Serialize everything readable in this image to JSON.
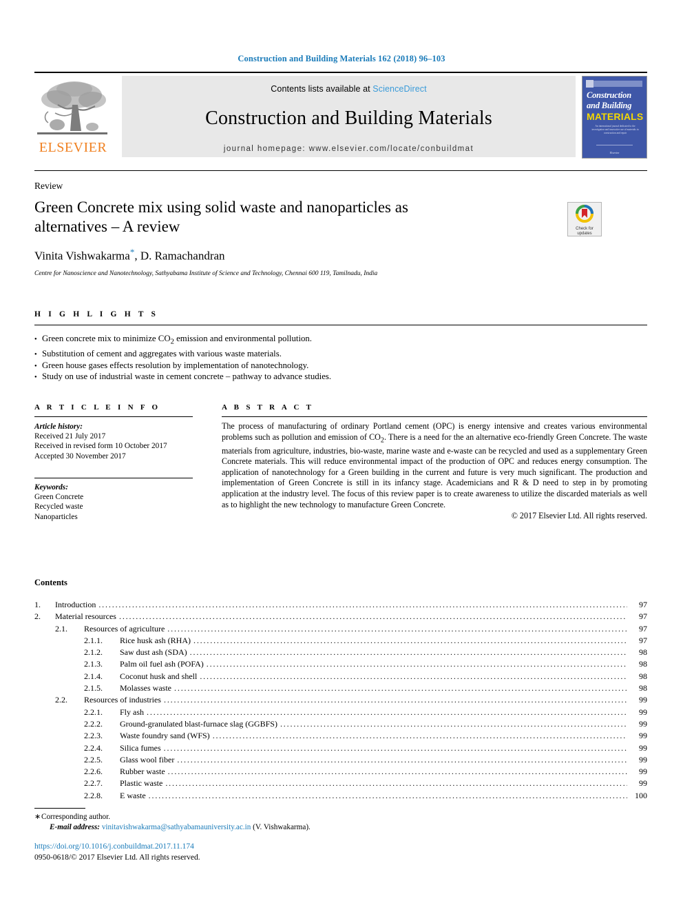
{
  "running_head": "Construction and Building Materials 162 (2018) 96–103",
  "masthead": {
    "publisher_logo_label": "ELSEVIER",
    "contents_prefix": "Contents lists available at ",
    "contents_link": "ScienceDirect",
    "journal_title": "Construction and Building Materials",
    "homepage": "journal homepage: www.elsevier.com/locate/conbuildmat",
    "cover": {
      "line1": "Construction",
      "line2": "and Building",
      "line3": "MATERIALS",
      "blurb": "An international journal dedicated to the investigation and innovative use of materials in construction and repair",
      "footer": "Elsevier"
    }
  },
  "article": {
    "doc_type": "Review",
    "title": "Green Concrete mix using solid waste and nanoparticles as alternatives – A review",
    "authors": "Vinita Vishwakarma",
    "authors_rest": ", D. Ramachandran",
    "corresponding_marker": "*",
    "affiliation": "Centre for Nanoscience and Nanotechnology, Sathyabama Institute of Science and Technology, Chennai 600 119, Tamilnadu, India",
    "crossmark_line1": "Check for",
    "crossmark_line2": "updates"
  },
  "highlights": {
    "heading": "H I G H L I G H T S",
    "items": [
      "Green concrete mix to minimize CO2 emission and environmental pollution.",
      "Substitution of cement and aggregates with various waste materials.",
      "Green house gases effects resolution by implementation of nanotechnology.",
      "Study on use of industrial waste in cement concrete – pathway to advance studies."
    ]
  },
  "article_info": {
    "heading": "A R T I C L E    I N F O",
    "history_label": "Article history:",
    "history": [
      "Received 21 July 2017",
      "Received in revised form 10 October 2017",
      "Accepted 30 November 2017"
    ],
    "keywords_label": "Keywords:",
    "keywords": [
      "Green Concrete",
      "Recycled waste",
      "Nanoparticles"
    ]
  },
  "abstract": {
    "heading": "A B S T R A C T",
    "text": "The process of manufacturing of ordinary Portland cement (OPC) is energy intensive and creates various environmental problems such as pollution and emission of CO2. There is a need for the an alternative eco-friendly Green Concrete. The waste materials from agriculture, industries, bio-waste, marine waste and e-waste can be recycled and used as a supplementary Green Concrete materials. This will reduce environmental impact of the production of OPC and reduces energy consumption. The application of nanotechnology for a Green building in the current and future is very much significant. The production and implementation of Green Concrete is still in its infancy stage. Academicians and R & D need to step in by promoting application at the industry level. The focus of this review paper is to create awareness to utilize the discarded materials as well as to highlight the new technology to manufacture Green Concrete.",
    "copyright": "© 2017 Elsevier Ltd. All rights reserved."
  },
  "contents": {
    "heading": "Contents",
    "entries": [
      {
        "level": 1,
        "num": "1.",
        "label": "Introduction",
        "page": "97"
      },
      {
        "level": 1,
        "num": "2.",
        "label": "Material resources",
        "page": "97"
      },
      {
        "level": 2,
        "num": "2.1.",
        "label": "Resources of agriculture",
        "page": "97"
      },
      {
        "level": 3,
        "num": "2.1.1.",
        "label": "Rice husk ash (RHA)",
        "page": "97"
      },
      {
        "level": 3,
        "num": "2.1.2.",
        "label": "Saw dust ash (SDA)",
        "page": "98"
      },
      {
        "level": 3,
        "num": "2.1.3.",
        "label": "Palm oil fuel ash (POFA)",
        "page": "98"
      },
      {
        "level": 3,
        "num": "2.1.4.",
        "label": "Coconut husk and shell",
        "page": "98"
      },
      {
        "level": 3,
        "num": "2.1.5.",
        "label": "Molasses waste",
        "page": "98"
      },
      {
        "level": 2,
        "num": "2.2.",
        "label": "Resources of industries",
        "page": "99"
      },
      {
        "level": 3,
        "num": "2.2.1.",
        "label": "Fly ash",
        "page": "99"
      },
      {
        "level": 3,
        "num": "2.2.2.",
        "label": "Ground-granulated blast-furnace slag (GGBFS)",
        "page": "99"
      },
      {
        "level": 3,
        "num": "2.2.3.",
        "label": "Waste foundry sand (WFS)",
        "page": "99"
      },
      {
        "level": 3,
        "num": "2.2.4.",
        "label": "Silica fumes",
        "page": "99"
      },
      {
        "level": 3,
        "num": "2.2.5.",
        "label": "Glass wool fiber",
        "page": "99"
      },
      {
        "level": 3,
        "num": "2.2.6.",
        "label": "Rubber waste",
        "page": "99"
      },
      {
        "level": 3,
        "num": "2.2.7.",
        "label": "Plastic waste",
        "page": "99"
      },
      {
        "level": 3,
        "num": "2.2.8.",
        "label": "E waste",
        "page": "100"
      }
    ]
  },
  "footer": {
    "corresponding": "Corresponding author.",
    "email_label": "E-mail address:",
    "email": "vinitavishwakarma@sathyabamauniversity.ac.in",
    "email_owner": "(V. Vishwakarma).",
    "doi": "https://doi.org/10.1016/j.conbuildmat.2017.11.174",
    "issn": "0950-0618/© 2017 Elsevier Ltd. All rights reserved."
  },
  "colors": {
    "link": "#1a7bb9",
    "sciencedirect": "#3a9bd9",
    "elsevier_orange": "#f08020",
    "cover_blue": "#3f57a8",
    "cover_yellow": "#f5d800",
    "masthead_bg": "#e8e8e8"
  }
}
